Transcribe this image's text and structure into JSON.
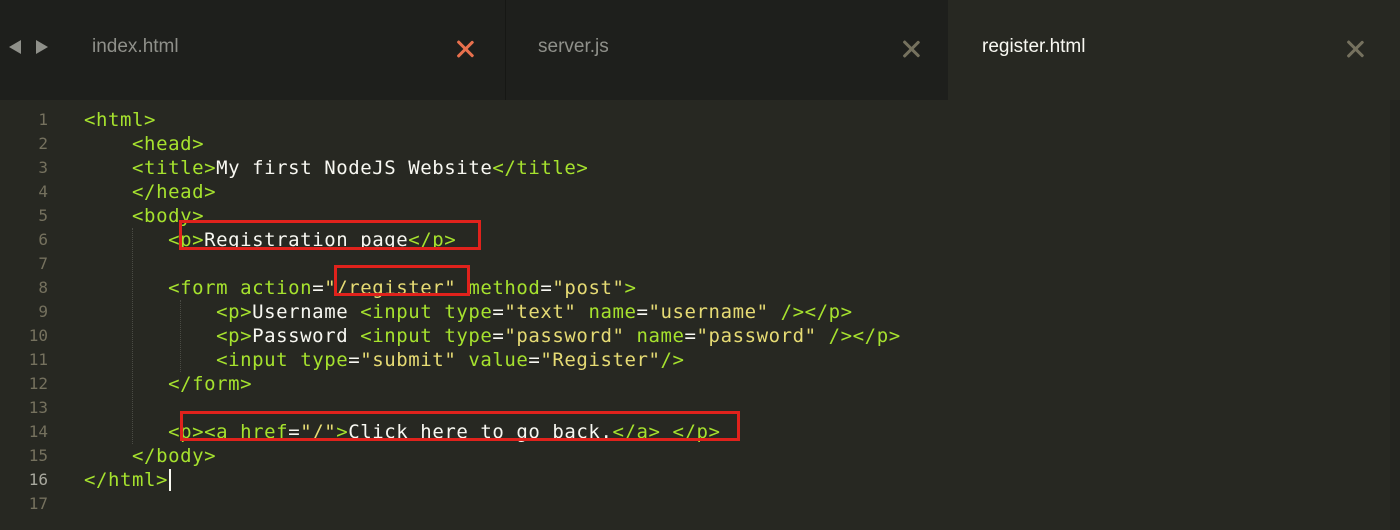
{
  "nav": {
    "back_icon": "triangle-left-icon",
    "forward_icon": "triangle-right-icon"
  },
  "tabs": [
    {
      "label": "index.html",
      "active": false,
      "modified": true,
      "close_icon": "close-icon"
    },
    {
      "label": "server.js",
      "active": false,
      "modified": false,
      "close_icon": "close-icon"
    },
    {
      "label": "register.html",
      "active": true,
      "modified": false,
      "close_icon": "close-icon"
    }
  ],
  "colors": {
    "background": "#272822",
    "tag": "#a6e22e",
    "string": "#e6db74",
    "text": "#f8f8f2",
    "line_number": "#75715e",
    "modified_indicator": "#e8704d",
    "highlight_box": "#e0221c"
  },
  "editor": {
    "current_line": 16,
    "line_numbers": [
      "1",
      "2",
      "3",
      "4",
      "5",
      "6",
      "7",
      "8",
      "9",
      "10",
      "11",
      "12",
      "13",
      "14",
      "15",
      "16",
      "17"
    ],
    "lines": [
      {
        "indent": "",
        "tokens": [
          [
            "tag",
            "<html>"
          ]
        ]
      },
      {
        "indent": "    ",
        "tokens": [
          [
            "tag",
            "<head>"
          ]
        ]
      },
      {
        "indent": "    ",
        "tokens": [
          [
            "tag",
            "<title>"
          ],
          [
            "txt",
            "My first NodeJS Website"
          ],
          [
            "tag",
            "</title>"
          ]
        ]
      },
      {
        "indent": "    ",
        "tokens": [
          [
            "tag",
            "</head>"
          ]
        ]
      },
      {
        "indent": "    ",
        "tokens": [
          [
            "tag",
            "<body>"
          ]
        ]
      },
      {
        "indent": "       ",
        "tokens": [
          [
            "tag",
            "<p>"
          ],
          [
            "txt",
            "Registration page"
          ],
          [
            "tag",
            "</p>"
          ]
        ]
      },
      {
        "indent": "",
        "tokens": []
      },
      {
        "indent": "       ",
        "tokens": [
          [
            "tag",
            "<form "
          ],
          [
            "attr",
            "action"
          ],
          [
            "br",
            "="
          ],
          [
            "str",
            "\"/register\""
          ],
          [
            "br",
            " "
          ],
          [
            "attr",
            "method"
          ],
          [
            "br",
            "="
          ],
          [
            "str",
            "\"post\""
          ],
          [
            "tag",
            ">"
          ]
        ]
      },
      {
        "indent": "           ",
        "tokens": [
          [
            "tag",
            "<p>"
          ],
          [
            "txt",
            "Username "
          ],
          [
            "tag",
            "<input "
          ],
          [
            "attr",
            "type"
          ],
          [
            "br",
            "="
          ],
          [
            "str",
            "\"text\""
          ],
          [
            "br",
            " "
          ],
          [
            "attr",
            "name"
          ],
          [
            "br",
            "="
          ],
          [
            "str",
            "\"username\""
          ],
          [
            "br",
            " "
          ],
          [
            "tag",
            "/></p>"
          ]
        ]
      },
      {
        "indent": "           ",
        "tokens": [
          [
            "tag",
            "<p>"
          ],
          [
            "txt",
            "Password "
          ],
          [
            "tag",
            "<input "
          ],
          [
            "attr",
            "type"
          ],
          [
            "br",
            "="
          ],
          [
            "str",
            "\"password\""
          ],
          [
            "br",
            " "
          ],
          [
            "attr",
            "name"
          ],
          [
            "br",
            "="
          ],
          [
            "str",
            "\"password\""
          ],
          [
            "br",
            " "
          ],
          [
            "tag",
            "/></p>"
          ]
        ]
      },
      {
        "indent": "           ",
        "tokens": [
          [
            "tag",
            "<input "
          ],
          [
            "attr",
            "type"
          ],
          [
            "br",
            "="
          ],
          [
            "str",
            "\"submit\""
          ],
          [
            "br",
            " "
          ],
          [
            "attr",
            "value"
          ],
          [
            "br",
            "="
          ],
          [
            "str",
            "\"Register\""
          ],
          [
            "tag",
            "/>"
          ]
        ]
      },
      {
        "indent": "       ",
        "tokens": [
          [
            "tag",
            "</form>"
          ]
        ]
      },
      {
        "indent": "",
        "tokens": []
      },
      {
        "indent": "       ",
        "tokens": [
          [
            "tag",
            "<p><a "
          ],
          [
            "attr",
            "href"
          ],
          [
            "br",
            "="
          ],
          [
            "str",
            "\"/\""
          ],
          [
            "tag",
            ">"
          ],
          [
            "txt",
            "Click here to go back."
          ],
          [
            "tag",
            "</a> </p>"
          ]
        ]
      },
      {
        "indent": "    ",
        "tokens": [
          [
            "tag",
            "</body>"
          ]
        ]
      },
      {
        "indent": "",
        "tokens": [
          [
            "tag",
            "</html>"
          ]
        ]
      },
      {
        "indent": "",
        "tokens": []
      }
    ]
  }
}
